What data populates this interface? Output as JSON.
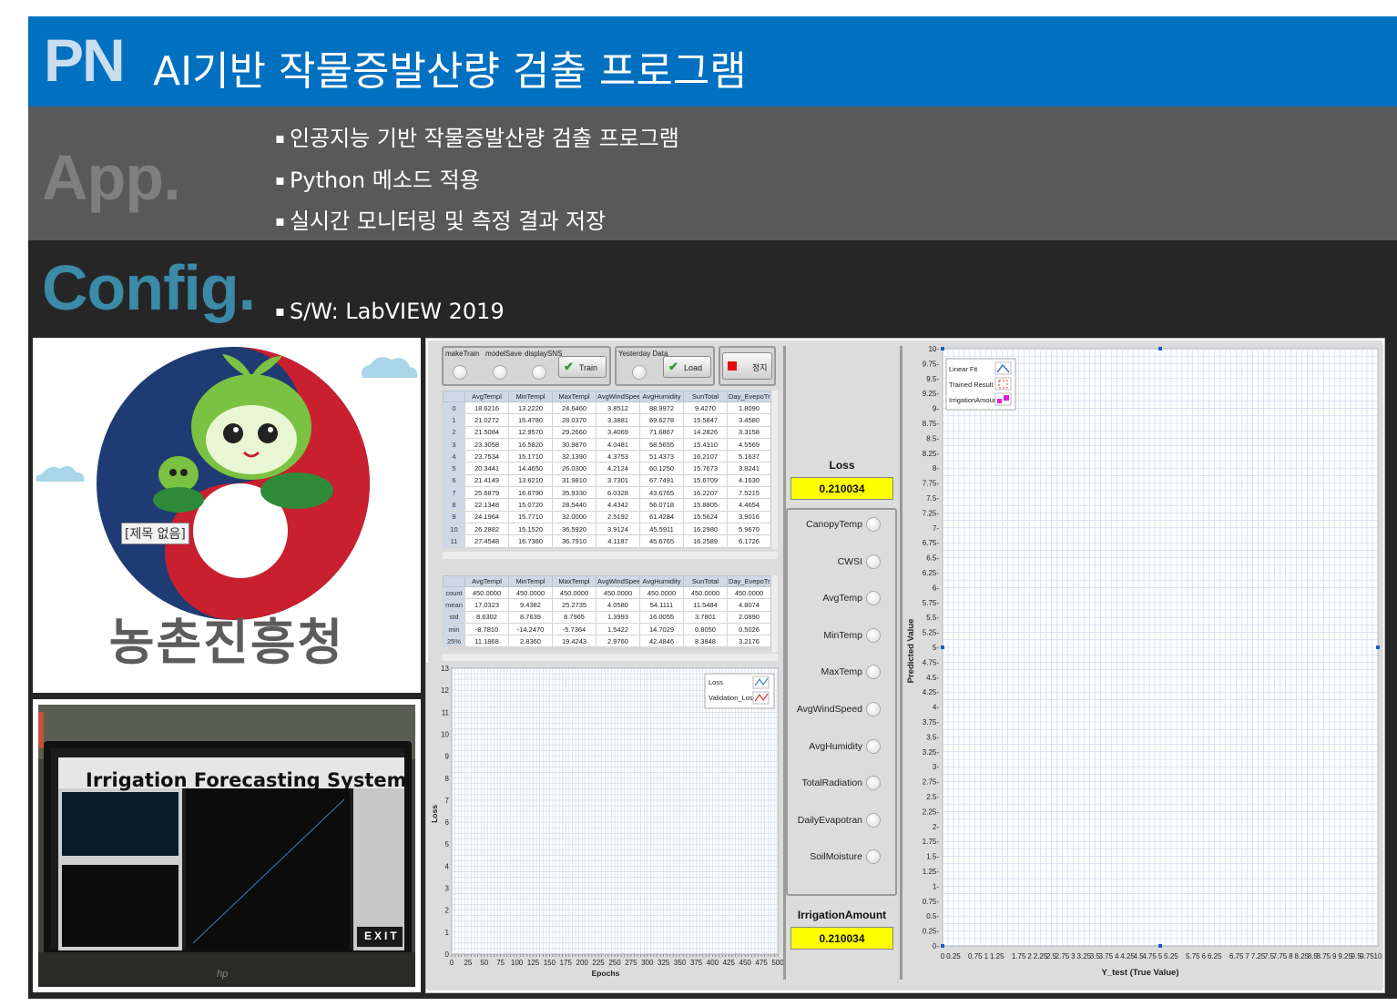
{
  "header": {
    "tag": "PN",
    "title": "AI기반 작물증발산량 검출 프로그램"
  },
  "app_section": {
    "tag": "App.",
    "bullets": [
      "인공지능 기반 작물증발산량 검출 프로그램",
      "Python 메소드 적용",
      "실시간 모니터링 및 측정 결과 저장"
    ]
  },
  "config_section": {
    "tag": "Config.",
    "bullets": [
      "S/W: LabVIEW 2019"
    ]
  },
  "logo_panel": {
    "caption": "[제목 없음]",
    "org_name": "농촌진흥청"
  },
  "photo_panel": {
    "screen_title": "Irrigation Forecasting System",
    "exit_label": "EXIT",
    "brand": "hp"
  },
  "labview": {
    "toggles": [
      "makeTrain",
      "modelSave",
      "displaySNS"
    ],
    "train_button": "Train",
    "yesterday_label": "Yesterday Data",
    "load_button": "Load",
    "stop_button": "정지",
    "train_table": {
      "columns": [
        "AvgTempl",
        "MinTempl",
        "MaxTempl",
        "AvgWindSpeed",
        "AvgHumidity",
        "SunTotal",
        "Day_EvepoTrans"
      ],
      "rows": [
        {
          "id": "0",
          "v": [
            "18.6216",
            "13.2220",
            "24.6460",
            "3.8512",
            "88.9972",
            "9.4270",
            "1.8090"
          ]
        },
        {
          "id": "1",
          "v": [
            "21.0272",
            "15.4780",
            "28.0370",
            "3.3881",
            "69.6278",
            "15.5847",
            "3.4580"
          ]
        },
        {
          "id": "2",
          "v": [
            "21.5084",
            "12.9570",
            "29.2660",
            "3.4069",
            "71.6867",
            "14.2826",
            "3.3158"
          ]
        },
        {
          "id": "3",
          "v": [
            "23.3058",
            "16.5820",
            "30.9870",
            "4.0481",
            "58.5655",
            "15.4310",
            "4.5569"
          ]
        },
        {
          "id": "4",
          "v": [
            "23.7534",
            "15.1710",
            "32.1390",
            "4.3753",
            "51.4373",
            "16.2107",
            "5.1637"
          ]
        },
        {
          "id": "5",
          "v": [
            "20.3441",
            "14.4650",
            "26.0300",
            "4.2124",
            "60.1250",
            "15.7673",
            "3.8241"
          ]
        },
        {
          "id": "6",
          "v": [
            "21.4149",
            "13.6210",
            "31.9810",
            "3.7301",
            "67.7491",
            "15.6709",
            "4.1630"
          ]
        },
        {
          "id": "7",
          "v": [
            "25.6879",
            "16.6790",
            "35.9330",
            "6.0328",
            "43.6765",
            "16.2207",
            "7.5215"
          ]
        },
        {
          "id": "8",
          "v": [
            "22.1348",
            "15.0720",
            "28.5440",
            "4.4342",
            "56.0718",
            "15.8805",
            "4.4654"
          ]
        },
        {
          "id": "9",
          "v": [
            "24.1964",
            "15.7710",
            "32.0000",
            "2.5192",
            "61.4284",
            "15.5624",
            "3.9016"
          ]
        },
        {
          "id": "10",
          "v": [
            "26.2882",
            "15.1520",
            "36.5920",
            "3.9124",
            "45.5911",
            "16.2980",
            "5.9670"
          ]
        },
        {
          "id": "11",
          "v": [
            "27.4548",
            "16.7360",
            "36.7910",
            "4.1187",
            "45.6765",
            "16.2589",
            "6.1726"
          ]
        }
      ]
    },
    "stats_table": {
      "columns": [
        "AvgTempl",
        "MinTempl",
        "MaxTempl",
        "AvgWindSpeed",
        "AvgHumidity",
        "SunTotal",
        "Day_EvepoTrans"
      ],
      "rows": [
        {
          "id": "count",
          "v": [
            "450.0000",
            "450.0000",
            "450.0000",
            "450.0000",
            "450.0000",
            "450.0000",
            "450.0000"
          ]
        },
        {
          "id": "mean",
          "v": [
            "17.0323",
            "9.4382",
            "25.2735",
            "4.0580",
            "54.1111",
            "11.5484",
            "4.8074"
          ]
        },
        {
          "id": "std",
          "v": [
            "8.6302",
            "8.7639",
            "8.7965",
            "1.3993",
            "16.0055",
            "3.7801",
            "2.0890"
          ]
        },
        {
          "id": "min",
          "v": [
            "-8.7810",
            "-14.2470",
            "-5.7364",
            "1.5422",
            "14.7029",
            "0.8050",
            "0.5026"
          ]
        },
        {
          "id": "25%",
          "v": [
            "11.1868",
            "2.8360",
            "19.4243",
            "2.9760",
            "42.4846",
            "8.3848",
            "3.2176"
          ]
        }
      ]
    },
    "loss_label": "Loss",
    "loss_value": "0.210034",
    "irrigation_label": "IrrigationAmount",
    "irrigation_value": "0.210034",
    "variables": [
      "CanopyTemp",
      "CWSI",
      "AvgTemp",
      "MinTemp",
      "MaxTemp",
      "AvgWindSpeed",
      "AvgHumidity",
      "TotalRadiation",
      "DailyEvapotran",
      "SoilMoisture"
    ]
  },
  "chart_data": [
    {
      "type": "line",
      "xlabel": "Epochs",
      "ylabel": "Loss",
      "xlim": [
        0,
        500
      ],
      "ylim": [
        0,
        13
      ],
      "x_ticks": [
        0,
        25,
        50,
        75,
        100,
        125,
        150,
        175,
        200,
        225,
        250,
        275,
        300,
        325,
        350,
        375,
        400,
        425,
        450,
        475,
        500
      ],
      "y_ticks": [
        0,
        1,
        2,
        3,
        4,
        5,
        6,
        7,
        8,
        9,
        10,
        11,
        12,
        13
      ],
      "grid": true,
      "legend_position": "top-right",
      "series": [
        {
          "name": "Loss",
          "color": "#3d7fbf",
          "values": []
        },
        {
          "name": "Validation_Loss",
          "color": "#e03030",
          "values": []
        }
      ]
    },
    {
      "type": "scatter",
      "xlabel": "Y_test (True Value)",
      "ylabel": "Predicted Value",
      "xlim": [
        0,
        10
      ],
      "ylim": [
        0,
        10
      ],
      "x_ticks": [
        "0",
        "0.25",
        "0.75",
        "1",
        "1.25",
        "1.75",
        "2",
        "2.25",
        "2.5",
        "2.75",
        "3",
        "3.25",
        "3.5",
        "3.75",
        "4",
        "4.25",
        "4.5",
        "4.75",
        "5",
        "5.25",
        "5.75",
        "6",
        "6.25",
        "6.75",
        "7",
        "7.25",
        "7.5",
        "7.75",
        "8",
        "8.25",
        "8.5",
        "8.75",
        "9",
        "9.25",
        "9.5",
        "9.75",
        "10"
      ],
      "y_ticks": [
        "0",
        "0.25",
        "0.5",
        "0.75",
        "1",
        "1.25",
        "1.5",
        "1.75",
        "2",
        "2.25",
        "2.5",
        "2.75",
        "3",
        "3.25",
        "3.5",
        "3.75",
        "4",
        "4.25",
        "4.5",
        "4.75",
        "5",
        "5.25",
        "5.5",
        "5.75",
        "6",
        "6.25",
        "6.5",
        "6.75",
        "7",
        "7.25",
        "7.5",
        "7.75",
        "8",
        "8.25",
        "8.5",
        "8.75",
        "9",
        "9.25",
        "9.5",
        "9.75",
        "10"
      ],
      "grid": true,
      "legend_position": "top-left",
      "series": [
        {
          "name": "Linear Fit",
          "color": "#3d7fbf",
          "points": []
        },
        {
          "name": "Trained Result",
          "color": "#e03030",
          "points": []
        },
        {
          "name": "IrrigationAmount",
          "color": "#e020e0",
          "points": []
        }
      ],
      "cursor_markers": [
        {
          "x": 0,
          "y": 10
        },
        {
          "x": 5,
          "y": 10
        },
        {
          "x": 0,
          "y": 5
        },
        {
          "x": 10,
          "y": 5
        },
        {
          "x": 0,
          "y": 0
        },
        {
          "x": 5,
          "y": 0
        }
      ]
    }
  ]
}
